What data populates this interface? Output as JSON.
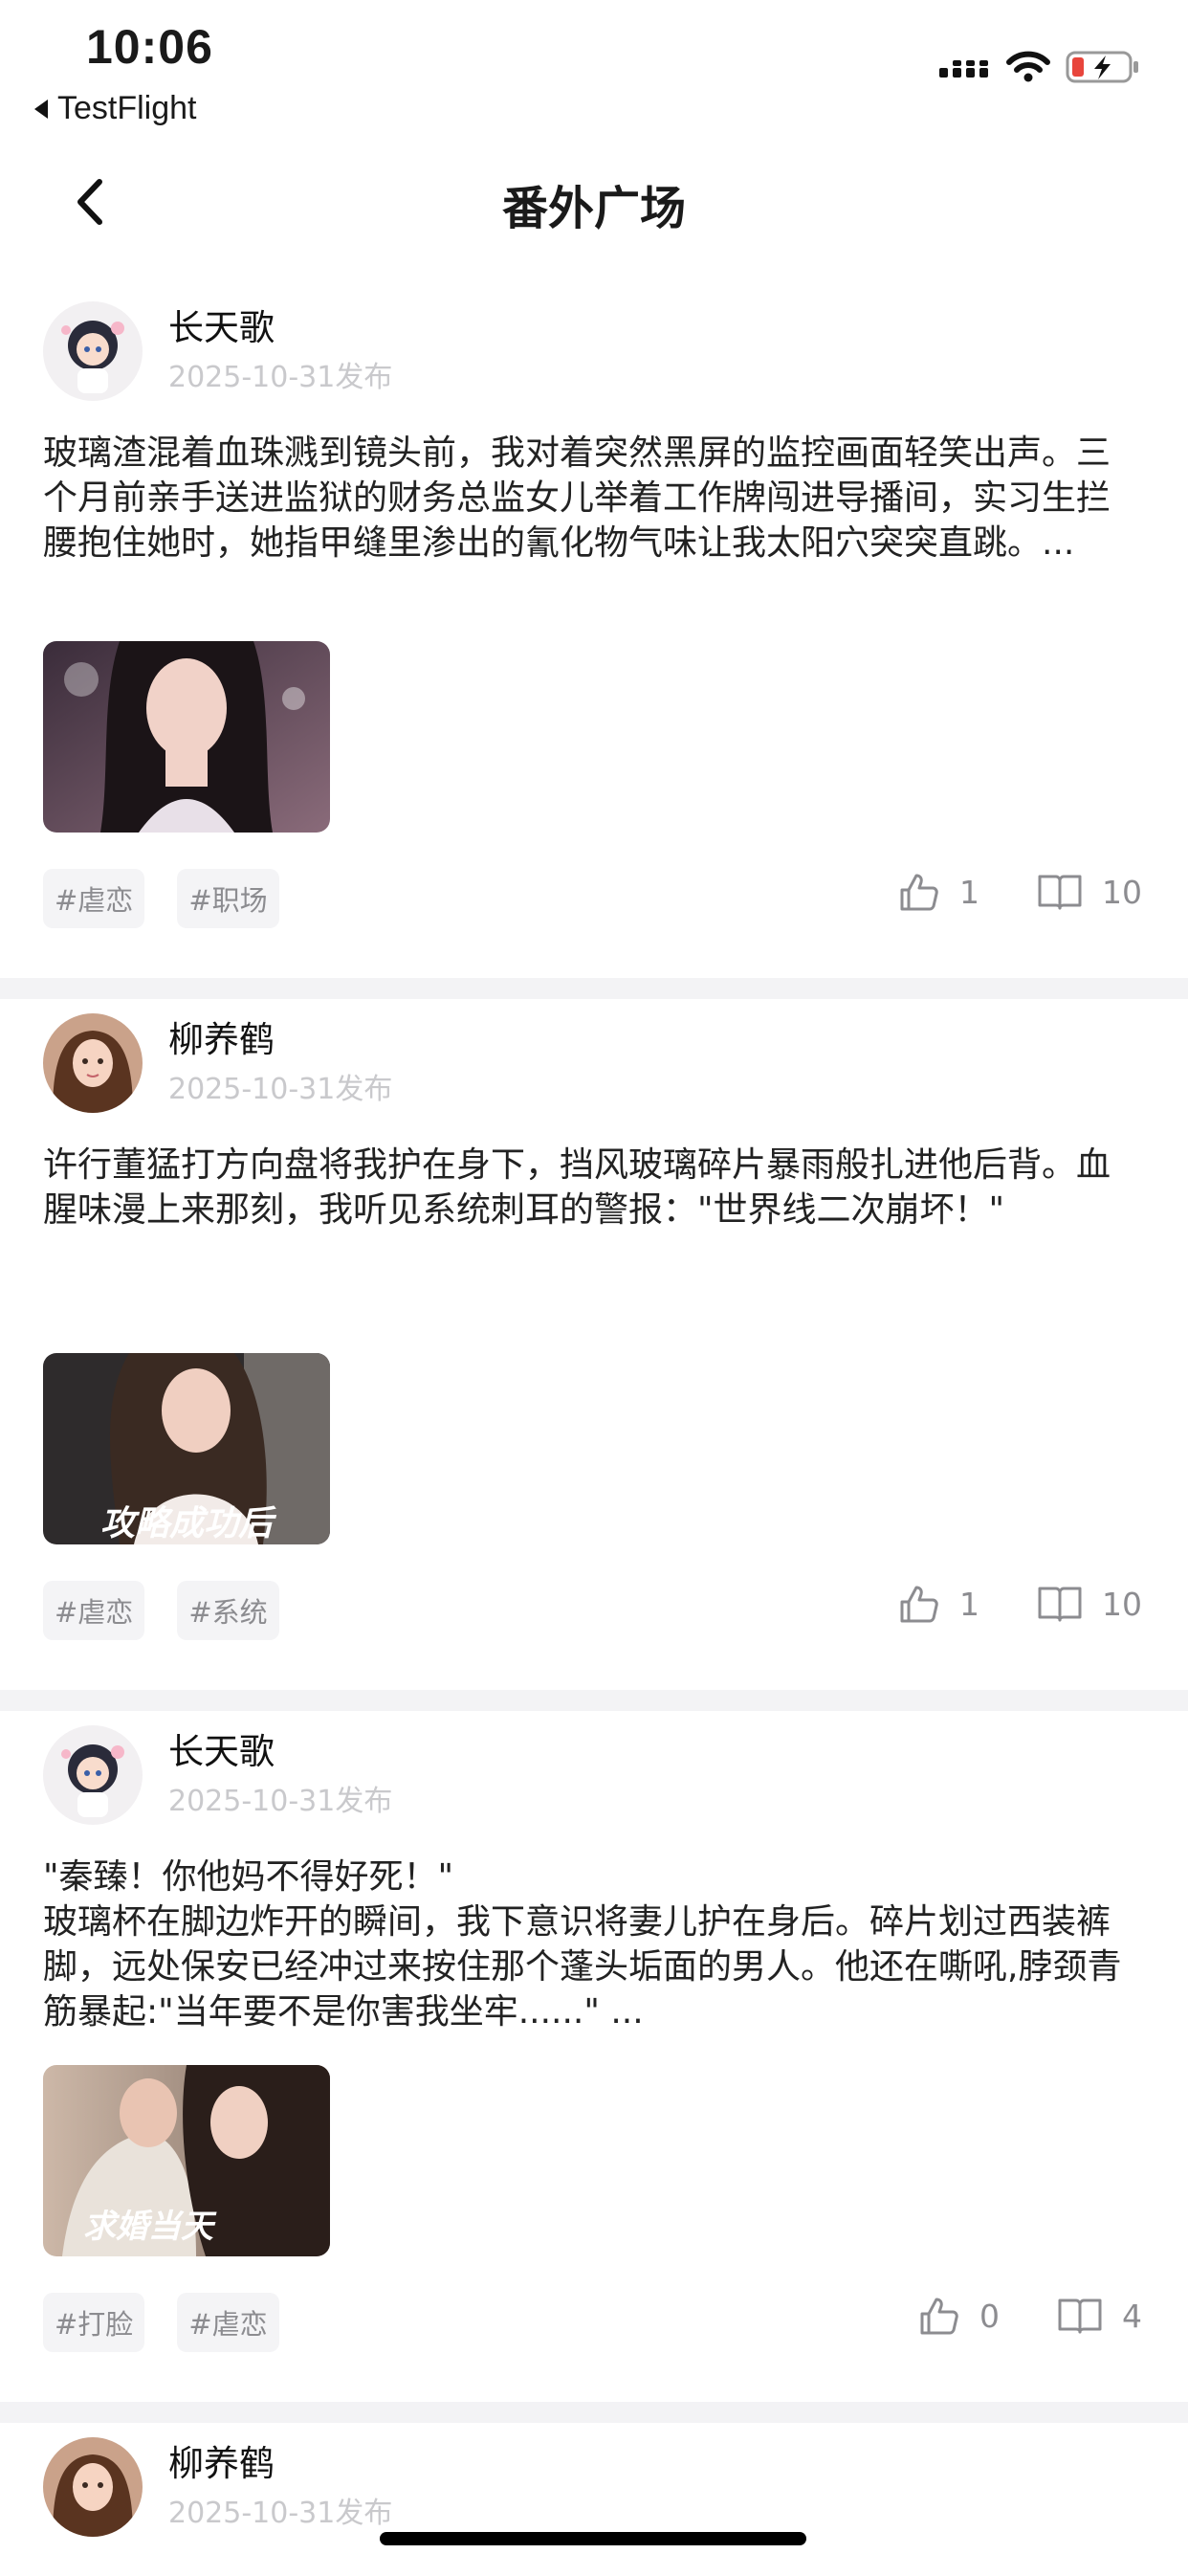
{
  "status": {
    "time": "10:06",
    "back_app": "TestFlight"
  },
  "nav": {
    "title": "番外广场"
  },
  "posts": [
    {
      "author": "长天歌",
      "date": "2025-10-31发布",
      "content": "玻璃渣混着血珠溅到镜头前，我对着突然黑屏的监控画面轻笑出声。三个月前亲手送进监狱的财务总监女儿举着工作牌闯进导播间，实习生拦腰抱住她时，她指甲缝里渗出的氰化物气味让我太阳穴突突直跳。...",
      "cover_text": "",
      "tags": [
        "#虐恋",
        "#职场"
      ],
      "likes": "1",
      "reads": "10"
    },
    {
      "author": "柳养鹤",
      "date": "2025-10-31发布",
      "content": "许行董猛打方向盘将我护在身下，挡风玻璃碎片暴雨般扎进他后背。血腥味漫上来那刻，我听见系统刺耳的警报：\"世界线二次崩坏！\"",
      "cover_text": "攻略成功后",
      "tags": [
        "#虐恋",
        "#系统"
      ],
      "likes": "1",
      "reads": "10"
    },
    {
      "author": "长天歌",
      "date": "2025-10-31发布",
      "content": "\"秦臻！你他妈不得好死！\"\n玻璃杯在脚边炸开的瞬间，我下意识将妻儿护在身后。碎片划过西装裤脚，远处保安已经冲过来按住那个蓬头垢面的男人。他还在嘶吼,脖颈青筋暴起:\"当年要不是你害我坐牢......\" ...",
      "cover_text": "求婚当天",
      "tags": [
        "#打脸",
        "#虐恋"
      ],
      "likes": "0",
      "reads": "4"
    }
  ],
  "partial_post": {
    "author": "柳养鹤",
    "date": "2025-10-31发布"
  }
}
